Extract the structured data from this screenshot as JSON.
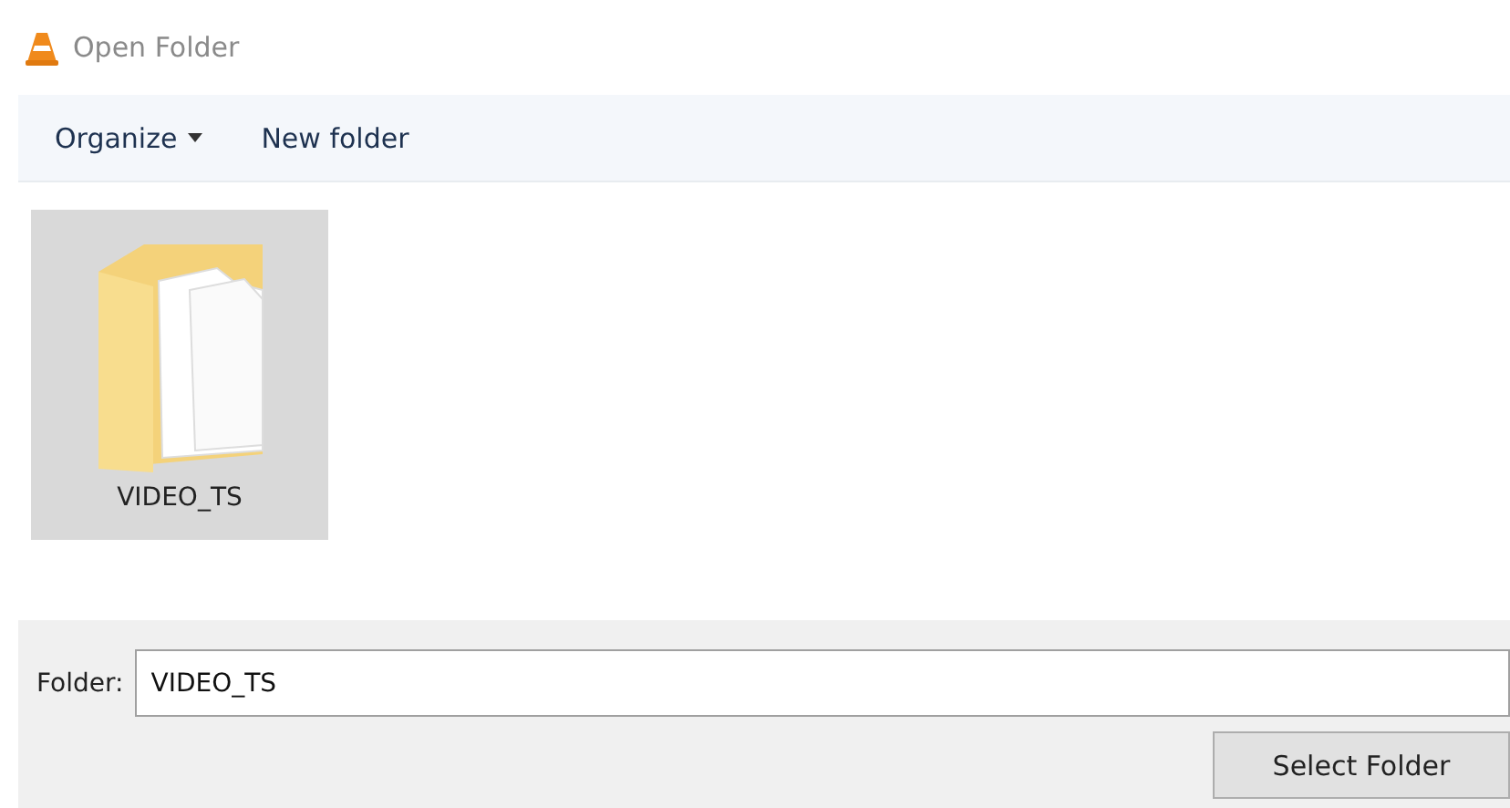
{
  "window": {
    "title": "Open Folder"
  },
  "toolbar": [
    {
      "label": "Organize",
      "kind": "menu"
    },
    {
      "label": "New folder",
      "kind": "button"
    }
  ],
  "items": [
    {
      "name": "VIDEO_TS",
      "selected": true
    }
  ],
  "folder_field": {
    "label": "Folder:",
    "value": "VIDEO_TS"
  },
  "buttons": [
    "Select Folder"
  ]
}
